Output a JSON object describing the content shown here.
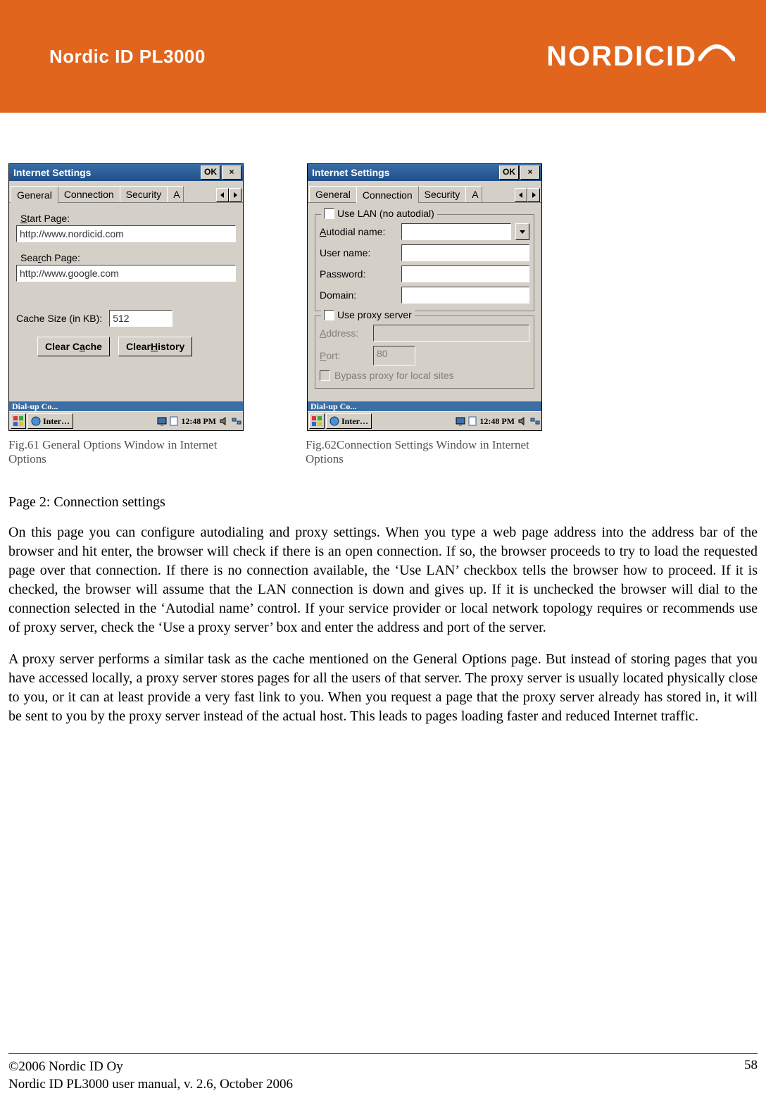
{
  "doc": {
    "header_title": "Nordic ID PL3000",
    "brand_text": "NORDICID"
  },
  "win_common": {
    "title": "Internet Settings",
    "ok": "OK",
    "close": "×",
    "tab_general": "General",
    "tab_connection": "Connection",
    "tab_security": "Security",
    "tab_trunc": "A",
    "cutbar": "Dial-up Co...",
    "task_label": "Inter…",
    "clock": "12:48 PM"
  },
  "general": {
    "start_label_pre": "S",
    "start_label_rest": "tart Page:",
    "start_value": "http://www.nordicid.com",
    "search_label_pre": "Sea",
    "search_label_u": "r",
    "search_label_post": "ch Page:",
    "search_value": "http://www.google.com",
    "cache_label_u": "C",
    "cache_label_rest": "ache Size (in KB):",
    "cache_value": "512",
    "clear_cache_pre": "Clear C",
    "clear_cache_u": "a",
    "clear_cache_post": "che",
    "clear_hist_pre": "Clear ",
    "clear_hist_u": "H",
    "clear_hist_post": "istory"
  },
  "connection": {
    "use_lan_pre": "Us",
    "use_lan_u": "e",
    "use_lan_post": " LAN (no autodial)",
    "autodial_u": "A",
    "autodial_rest": "utodial name:",
    "user": "User name:",
    "password": "Password:",
    "domain": "Domain:",
    "proxy_legend": "Use proxy server",
    "addr_u": "A",
    "addr_rest": "ddress:",
    "port_u": "P",
    "port_rest": "ort:",
    "port_value": "80",
    "bypass_u": "B",
    "bypass_rest": "ypass proxy for local sites"
  },
  "captions": {
    "left": "Fig.61 General Options Window in Internet Options",
    "right": "Fig.62Connection Settings Window in Internet Options"
  },
  "text": {
    "h": "Page 2: Connection settings",
    "p1": "On this page you can configure autodialing and proxy settings. When you type a web page address into the address bar of the browser and hit enter, the browser will check if there is an open connection. If so, the browser proceeds to try to load the requested page over that connection. If there is no connection available, the ‘Use LAN’ checkbox tells the browser how to proceed. If it is checked, the browser will assume that the LAN connection is down and gives up. If it is unchecked the browser will dial to the connection selected in the ‘Autodial name’ control. If your service provider or local network topology requires or recommends use of proxy server, check the ‘Use a proxy server’ box and enter the address and port of the server.",
    "p2": "A proxy server performs a similar task as the cache mentioned on the General Options page. But instead of storing pages that you have accessed locally, a proxy server stores pages for all the users of that server. The proxy server is usually located physically close to you, or it can at least provide a very fast link to you. When you request a page that the proxy server already has stored in, it will be sent to you by the proxy server instead of the actual host. This leads to pages loading faster and reduced Internet traffic."
  },
  "footer": {
    "copyright": "©2006 Nordic ID Oy",
    "manual": "Nordic ID PL3000 user manual, v. 2.6, October 2006",
    "page": "58"
  }
}
